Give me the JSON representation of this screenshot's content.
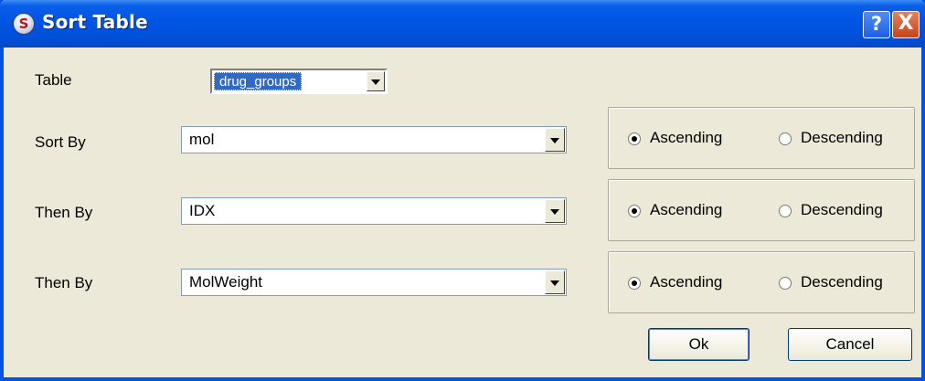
{
  "window": {
    "title": "Sort Table"
  },
  "titlebar_buttons": {
    "help": "?",
    "close": "X"
  },
  "table": {
    "label": "Table",
    "value": "drug_groups"
  },
  "sort_rows": [
    {
      "label": "Sort By",
      "value": "mol",
      "ascending_label": "Ascending",
      "descending_label": "Descending",
      "selected": "ascending"
    },
    {
      "label": "Then By",
      "value": "IDX",
      "ascending_label": "Ascending",
      "descending_label": "Descending",
      "selected": "ascending"
    },
    {
      "label": "Then By",
      "value": "MolWeight",
      "ascending_label": "Ascending",
      "descending_label": "Descending",
      "selected": "ascending"
    }
  ],
  "buttons": {
    "ok": "Ok",
    "cancel": "Cancel"
  }
}
